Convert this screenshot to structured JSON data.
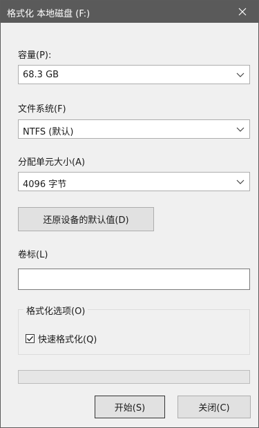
{
  "window": {
    "title": "格式化 本地磁盘 (F:)"
  },
  "capacity": {
    "label": "容量(P):",
    "value": "68.3 GB"
  },
  "filesystem": {
    "label": "文件系统(F)",
    "value": "NTFS (默认)"
  },
  "allocation": {
    "label": "分配单元大小(A)",
    "value": "4096 字节"
  },
  "restore_button": {
    "label": "还原设备的默认值(D)"
  },
  "volume_label": {
    "label": "卷标(L)",
    "value": ""
  },
  "format_options": {
    "legend": "格式化选项(O)",
    "quick_format": {
      "label": "快速格式化(Q)",
      "checked": true
    }
  },
  "progress": {
    "fraction": 0
  },
  "buttons": {
    "start": "开始(S)",
    "close": "关闭(C)"
  },
  "icons": {
    "close": "close-icon",
    "dropdown": "chevron-down-icon",
    "check": "check-icon"
  },
  "colors": {
    "titlebar": "#5a5a5a",
    "dialog_bg": "#f0f0f0",
    "progress_fill": "#06b025"
  }
}
